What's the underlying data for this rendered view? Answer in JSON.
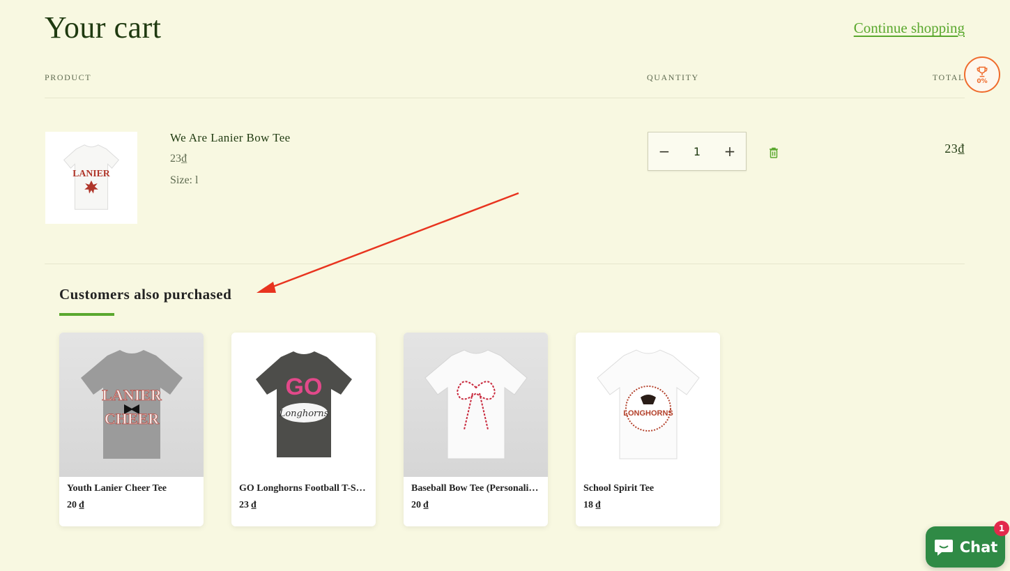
{
  "header": {
    "title": "Your cart",
    "continue_label": "Continue shopping"
  },
  "columns": {
    "product": "PRODUCT",
    "quantity": "QUANTITY",
    "total": "TOTAL"
  },
  "reward_badge": {
    "icon": "trophy-icon",
    "percent": "0%",
    "color": "#ef6b2c"
  },
  "cart_item": {
    "name": "We Are Lanier Bow Tee",
    "price": "23₫",
    "size": "Size: l",
    "quantity": "1",
    "minus": "−",
    "plus": "+",
    "line_total": "23₫",
    "image_text": "LANIER"
  },
  "recommendations": {
    "title": "Customers also purchased",
    "accent": "#5aa82e",
    "items": [
      {
        "name": "Youth Lanier Cheer Tee",
        "price": "20 ₫",
        "image_text_1": "LANIER",
        "image_text_2": "CHEER"
      },
      {
        "name": "GO Longhorns Football T-Shirt",
        "price": "23 ₫",
        "image_text_1": "GO",
        "image_text_2": "Longhorns"
      },
      {
        "name": "Baseball Bow Tee (Personalized)",
        "price": "20 ₫"
      },
      {
        "name": "School Spirit Tee",
        "price": "18 ₫",
        "image_text_1": "LONGHORNS"
      }
    ]
  },
  "chat": {
    "label": "Chat",
    "badge": "1",
    "color": "#2f8a45"
  }
}
